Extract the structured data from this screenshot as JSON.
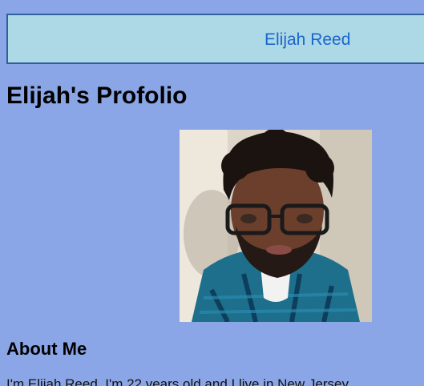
{
  "header": {
    "name_link": "Elijah Reed"
  },
  "page": {
    "title": "Elijah's Profolio"
  },
  "profile_photo": {
    "alt": "Elijah Reed portrait"
  },
  "about": {
    "heading": "About Me",
    "text": "I'm Elijah Reed. I'm 22 years old and I live in New Jersey."
  },
  "colors": {
    "page_background": "#8aa6e6",
    "header_background": "#add8e6",
    "header_border": "#2f5f9a",
    "link": "#1a66cc"
  }
}
